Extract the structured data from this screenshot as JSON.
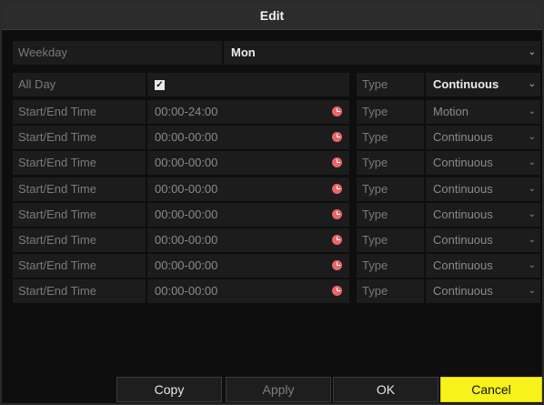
{
  "dialog": {
    "title": "Edit"
  },
  "weekday": {
    "label": "Weekday",
    "value": "Mon"
  },
  "allday": {
    "label": "All Day",
    "checked": true,
    "check_glyph": "✓",
    "type_label": "Type",
    "type_value": "Continuous"
  },
  "rows": [
    {
      "label": "Start/End Time",
      "time": "00:00-24:00",
      "type_label": "Type",
      "type_value": "Motion"
    },
    {
      "label": "Start/End Time",
      "time": "00:00-00:00",
      "type_label": "Type",
      "type_value": "Continuous"
    },
    {
      "label": "Start/End Time",
      "time": "00:00-00:00",
      "type_label": "Type",
      "type_value": "Continuous"
    },
    {
      "label": "Start/End Time",
      "time": "00:00-00:00",
      "type_label": "Type",
      "type_value": "Continuous"
    },
    {
      "label": "Start/End Time",
      "time": "00:00-00:00",
      "type_label": "Type",
      "type_value": "Continuous"
    },
    {
      "label": "Start/End Time",
      "time": "00:00-00:00",
      "type_label": "Type",
      "type_value": "Continuous"
    },
    {
      "label": "Start/End Time",
      "time": "00:00-00:00",
      "type_label": "Type",
      "type_value": "Continuous"
    },
    {
      "label": "Start/End Time",
      "time": "00:00-00:00",
      "type_label": "Type",
      "type_value": "Continuous"
    }
  ],
  "buttons": {
    "copy": "Copy",
    "apply": "Apply",
    "ok": "OK",
    "cancel": "Cancel"
  },
  "icons": {
    "dropdown": "chevron-down-icon",
    "clock": "clock-icon",
    "checkbox": "checkbox-icon"
  },
  "colors": {
    "cancel_bg": "#f7f21a",
    "clock": "#e8686a",
    "panel": "#1c1c1c"
  }
}
